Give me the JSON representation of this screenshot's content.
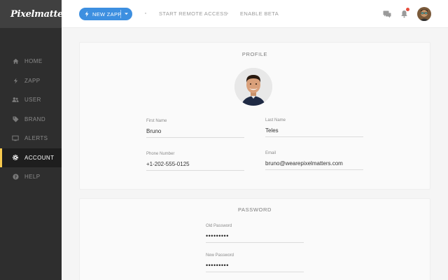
{
  "app": {
    "logo_text": "Pixelmatters"
  },
  "colors": {
    "accent_blue": "#3d8fe0",
    "active_marker": "#f6c94e",
    "notification_dot": "#e74c3c",
    "sidebar_bg": "#2e2e2e"
  },
  "sidebar": {
    "items": [
      {
        "label": "HOME",
        "icon": "home-icon"
      },
      {
        "label": "ZAPP",
        "icon": "bolt-icon"
      },
      {
        "label": "USER",
        "icon": "users-icon"
      },
      {
        "label": "BRAND",
        "icon": "tag-icon"
      },
      {
        "label": "ALERTS",
        "icon": "monitor-icon"
      },
      {
        "label": "ACCOUNT",
        "icon": "gear-icon",
        "active": true
      },
      {
        "label": "HELP",
        "icon": "help-icon"
      }
    ]
  },
  "topbar": {
    "new_zapp_label": "NEW ZAPP",
    "links": [
      "START REMOTE ACCESS",
      "ENABLE BETA"
    ],
    "icons": [
      "chat-icon",
      "bell-icon",
      "user-avatar"
    ]
  },
  "profile": {
    "title": "PROFILE",
    "fields": {
      "first_name": {
        "label": "First Name",
        "value": "Bruno"
      },
      "last_name": {
        "label": "Last Name",
        "value": "Teles"
      },
      "phone": {
        "label": "Phone Number",
        "value": "+1-202-555-0125"
      },
      "email": {
        "label": "Email",
        "value": "bruno@wearepixelmatters.com"
      }
    }
  },
  "password": {
    "title": "PASSWORD",
    "fields": {
      "old": {
        "label": "Old Password",
        "value": "•••••••••"
      },
      "new": {
        "label": "New Password",
        "value": "•••••••••"
      }
    }
  }
}
